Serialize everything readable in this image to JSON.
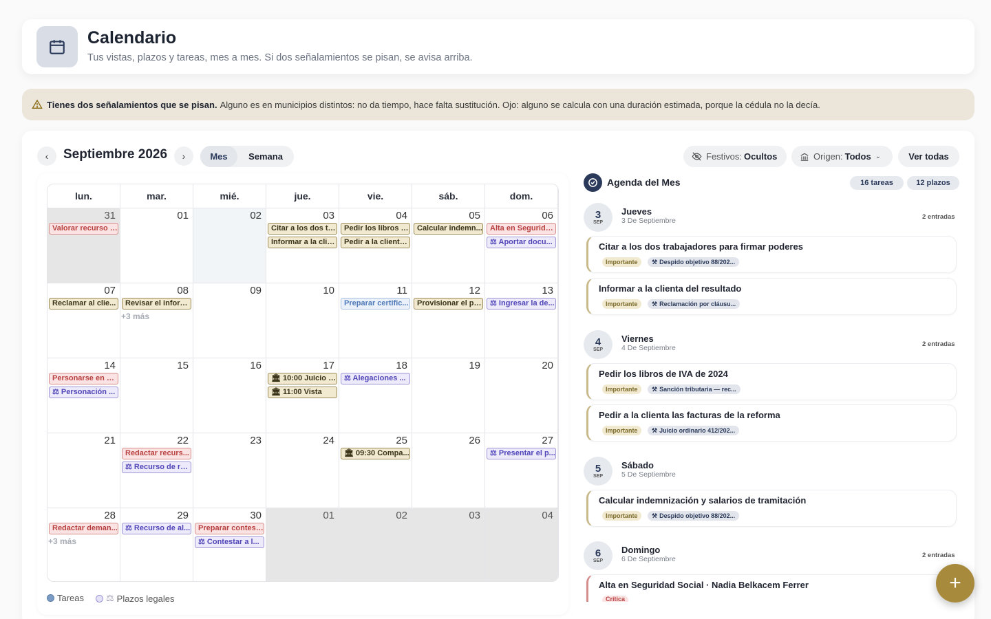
{
  "header": {
    "title": "Calendario",
    "subtitle": "Tus vistas, plazos y tareas, mes a mes. Si dos señalamientos se pisan, se avisa arriba."
  },
  "alert": {
    "strong": "Tienes dos señalamientos que se pisan.",
    "text": "Alguno es en municipios distintos: no da tiempo, hace falta sustitución. Ojo: alguno se calcula con una duración estimada, porque la cédula no la decía."
  },
  "toolbar": {
    "prev": "‹",
    "next": "›",
    "month": "Septiembre 2026",
    "view_month": "Mes",
    "view_week": "Semana",
    "holidays_label": "Festivos:",
    "holidays_value": "Ocultos",
    "origin_label": "Origen:",
    "origin_value": "Todos",
    "see_all": "Ver todas"
  },
  "calendar": {
    "weekdays": [
      "lun.",
      "mar.",
      "mié.",
      "jue.",
      "vie.",
      "sáb.",
      "dom."
    ],
    "days": [
      {
        "n": "31",
        "gray": true,
        "events": [
          {
            "t": "Valorar recurso f...",
            "c": "red"
          }
        ]
      },
      {
        "n": "01",
        "events": []
      },
      {
        "n": "02",
        "today": true,
        "events": []
      },
      {
        "n": "03",
        "events": [
          {
            "t": "Citar a los dos tr...",
            "c": "gold"
          },
          {
            "t": "Informar a la clie...",
            "c": "gold"
          }
        ]
      },
      {
        "n": "04",
        "events": [
          {
            "t": "Pedir los libros d...",
            "c": "gold"
          },
          {
            "t": "Pedir a la clienta...",
            "c": "gold"
          }
        ]
      },
      {
        "n": "05",
        "events": [
          {
            "t": "Calcular indemn...",
            "c": "gold"
          }
        ]
      },
      {
        "n": "06",
        "events": [
          {
            "t": "Alta en Segurida...",
            "c": "red"
          },
          {
            "t": "⚖ Aportar docu...",
            "c": "purple"
          }
        ]
      },
      {
        "n": "07",
        "events": [
          {
            "t": "Reclamar al clie...",
            "c": "gold"
          }
        ]
      },
      {
        "n": "08",
        "events": [
          {
            "t": "Revisar el inform...",
            "c": "gold"
          }
        ],
        "more": "+3 más"
      },
      {
        "n": "09",
        "events": []
      },
      {
        "n": "10",
        "events": []
      },
      {
        "n": "11",
        "events": [
          {
            "t": "Preparar certific...",
            "c": "blue"
          }
        ]
      },
      {
        "n": "12",
        "events": [
          {
            "t": "Provisionar el pa...",
            "c": "gold"
          }
        ]
      },
      {
        "n": "13",
        "events": [
          {
            "t": "⚖ Ingresar la de...",
            "c": "purple"
          }
        ]
      },
      {
        "n": "14",
        "events": [
          {
            "t": "Personarse en el ...",
            "c": "red"
          },
          {
            "t": "⚖ Personación ...",
            "c": "purple"
          }
        ]
      },
      {
        "n": "15",
        "events": []
      },
      {
        "n": "16",
        "events": []
      },
      {
        "n": "17",
        "events": [
          {
            "t": "🏛 10:00 Juicio · ...",
            "c": "gold"
          },
          {
            "t": "🏛 11:00 Vista",
            "c": "gold"
          }
        ]
      },
      {
        "n": "18",
        "events": [
          {
            "t": "⚖ Alegaciones ...",
            "c": "purple"
          }
        ]
      },
      {
        "n": "19",
        "events": []
      },
      {
        "n": "20",
        "events": []
      },
      {
        "n": "21",
        "events": []
      },
      {
        "n": "22",
        "events": [
          {
            "t": "Redactar recurs...",
            "c": "red"
          },
          {
            "t": "⚖ Recurso de re...",
            "c": "purple"
          }
        ]
      },
      {
        "n": "23",
        "events": []
      },
      {
        "n": "24",
        "events": []
      },
      {
        "n": "25",
        "events": [
          {
            "t": "🏛 09:30 Compa...",
            "c": "gold"
          }
        ]
      },
      {
        "n": "26",
        "events": []
      },
      {
        "n": "27",
        "events": [
          {
            "t": "⚖ Presentar el p...",
            "c": "purple"
          }
        ]
      },
      {
        "n": "28",
        "events": [
          {
            "t": "Redactar deman...",
            "c": "red"
          }
        ],
        "more": "+3 más"
      },
      {
        "n": "29",
        "events": [
          {
            "t": "⚖ Recurso de al...",
            "c": "purple"
          }
        ]
      },
      {
        "n": "30",
        "events": [
          {
            "t": "Preparar contest...",
            "c": "red"
          },
          {
            "t": "⚖ Contestar a l...",
            "c": "purple"
          }
        ]
      },
      {
        "n": "01",
        "gray": true,
        "events": []
      },
      {
        "n": "02",
        "gray": true,
        "events": []
      },
      {
        "n": "03",
        "gray": true,
        "events": []
      },
      {
        "n": "04",
        "gray": true,
        "events": []
      }
    ]
  },
  "legend": {
    "tasks": "Tareas",
    "deadlines": "Plazos legales"
  },
  "agenda": {
    "title": "Agenda del Mes",
    "tasks_badge": "16 tareas",
    "deadlines_badge": "12 plazos",
    "groups": [
      {
        "num": "3",
        "mon": "SEP",
        "name": "Jueves",
        "sub": "3 De Septiembre",
        "entries": "2 entradas",
        "items": [
          {
            "title": "Citar a los dos trabajadores para firmar poderes",
            "tag": "Importante",
            "case": "Despido objetivo 88/202..."
          },
          {
            "title": "Informar a la clienta del resultado",
            "tag": "Importante",
            "case": "Reclamación por cláusu..."
          }
        ]
      },
      {
        "num": "4",
        "mon": "SEP",
        "name": "Viernes",
        "sub": "4 De Septiembre",
        "entries": "2 entradas",
        "items": [
          {
            "title": "Pedir los libros de IVA de 2024",
            "tag": "Importante",
            "case": "Sanción tributaria — rec..."
          },
          {
            "title": "Pedir a la clienta las facturas de la reforma",
            "tag": "Importante",
            "case": "Juicio ordinario 412/202..."
          }
        ]
      },
      {
        "num": "5",
        "mon": "SEP",
        "name": "Sábado",
        "sub": "5 De Septiembre",
        "entries": "",
        "items": [
          {
            "title": "Calcular indemnización y salarios de tramitación",
            "tag": "Importante",
            "case": "Despido objetivo 88/202..."
          }
        ]
      },
      {
        "num": "6",
        "mon": "SEP",
        "name": "Domingo",
        "sub": "6 De Septiembre",
        "entries": "2 entradas",
        "items": [
          {
            "title": "Alta en Seguridad Social · Nadia Belkacem Ferrer",
            "tag": "Crítica",
            "case": ""
          }
        ]
      }
    ]
  },
  "fab": "+",
  "colors": {
    "accent": "#a88a3c",
    "navy": "#2b3a5a",
    "warning_bg": "#ebe6d9"
  }
}
